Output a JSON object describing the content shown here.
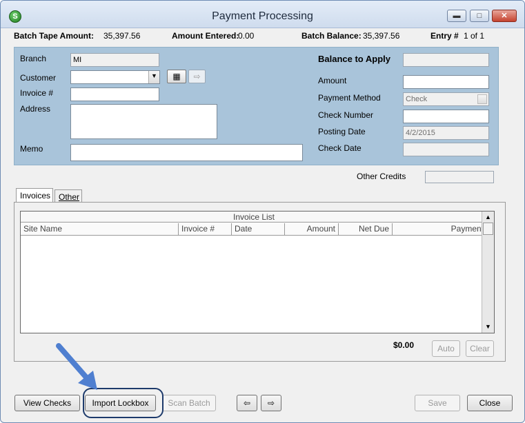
{
  "window": {
    "title": "Payment Processing",
    "app_icon_letter": "S"
  },
  "batch": {
    "tape_label": "Batch Tape Amount:",
    "tape_value": "35,397.56",
    "entered_label": "Amount Entered:",
    "entered_value": "0.00",
    "balance_label": "Batch Balance:",
    "balance_value": "35,397.56",
    "entry_label": "Entry #",
    "entry_value": "1 of 1"
  },
  "form": {
    "branch_label": "Branch",
    "branch_value": "MI",
    "customer_label": "Customer",
    "customer_value": "",
    "invoice_label": "Invoice #",
    "invoice_value": "",
    "address_label": "Address",
    "address_value": "",
    "memo_label": "Memo",
    "memo_value": "",
    "balance_to_apply_label": "Balance to Apply",
    "balance_to_apply_value": "",
    "amount_label": "Amount",
    "amount_value": "",
    "payment_method_label": "Payment Method",
    "payment_method_value": "Check",
    "check_number_label": "Check Number",
    "check_number_value": "",
    "posting_date_label": "Posting Date",
    "posting_date_value": "4/2/2015",
    "check_date_label": "Check Date",
    "check_date_value": "",
    "other_credits_label": "Other Credits",
    "other_credits_value": ""
  },
  "tabs": [
    {
      "label": "Invoices"
    },
    {
      "label": "Other"
    }
  ],
  "grid": {
    "title": "Invoice List",
    "columns": [
      "Site Name",
      "Invoice #",
      "Date",
      "Amount",
      "Net Due",
      "Payment"
    ]
  },
  "totals": {
    "payment_total": "$0.00"
  },
  "buttons": {
    "auto": "Auto",
    "clear": "Clear",
    "view_checks": "View Checks",
    "import_lockbox": "Import Lockbox",
    "scan_batch": "Scan Batch",
    "save": "Save",
    "close": "Close"
  },
  "colors": {
    "panel": "#a9c4da",
    "annotation_arrow": "#4f7fd0"
  },
  "icons": {
    "customer_lookup": "binoculars-icon",
    "customer_go": "arrow-right-icon",
    "prev": "arrow-left-icon",
    "next": "arrow-right-icon"
  }
}
